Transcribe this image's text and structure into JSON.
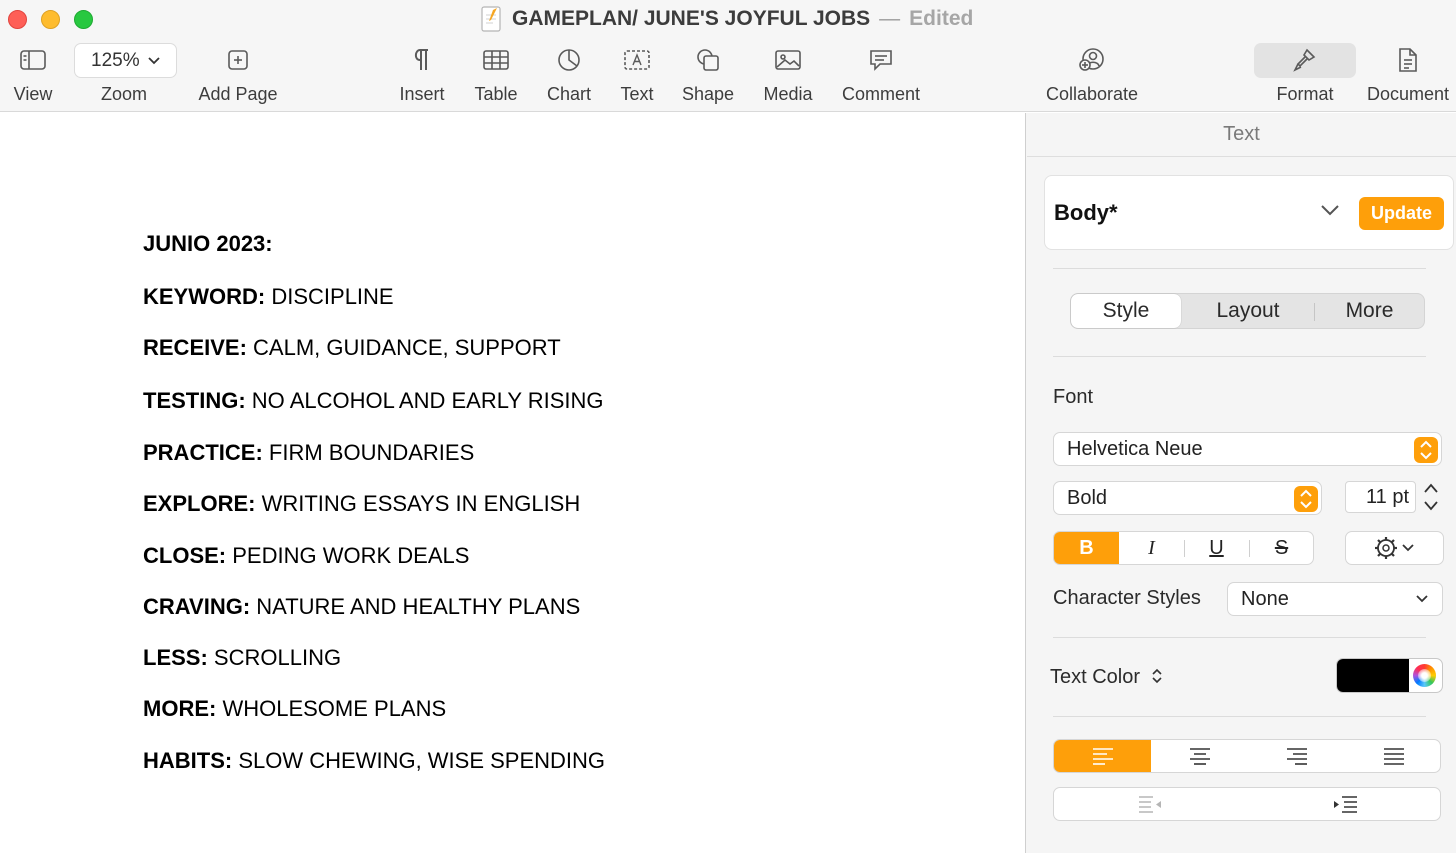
{
  "window": {
    "title": "GAMEPLAN/ JUNE'S JOYFUL JOBS",
    "separator": "—",
    "status": "Edited"
  },
  "toolbar": {
    "view_label": "View",
    "zoom_value": "125%",
    "zoom_label": "Zoom",
    "add_page_label": "Add Page",
    "insert_label": "Insert",
    "table_label": "Table",
    "chart_label": "Chart",
    "text_label": "Text",
    "shape_label": "Shape",
    "media_label": "Media",
    "comment_label": "Comment",
    "collaborate_label": "Collaborate",
    "format_label": "Format",
    "document_label": "Document"
  },
  "document": {
    "heading": "JUNIO 2023:",
    "lines": [
      {
        "key": "KEYWORD:",
        "value": "DISCIPLINE"
      },
      {
        "key": "RECEIVE:",
        "value": "CALM, GUIDANCE, SUPPORT"
      },
      {
        "key": "TESTING:",
        "value": "NO ALCOHOL AND EARLY RISING"
      },
      {
        "key": "PRACTICE:",
        "value": "FIRM BOUNDARIES"
      },
      {
        "key": "EXPLORE:",
        "value": "WRITING ESSAYS IN ENGLISH"
      },
      {
        "key": "CLOSE:",
        "value": "PEDING WORK DEALS"
      },
      {
        "key": "CRAVING:",
        "value": "NATURE AND HEALTHY PLANS"
      },
      {
        "key": "LESS:",
        "value": "SCROLLING"
      },
      {
        "key": "MORE:",
        "value": "WHOLESOME PLANS"
      },
      {
        "key": "HABITS:",
        "value": "SLOW CHEWING, WISE SPENDING"
      }
    ]
  },
  "sidebar": {
    "header": "Text",
    "paragraph_style": "Body*",
    "update_label": "Update",
    "tabs": [
      "Style",
      "Layout",
      "More"
    ],
    "font_label": "Font",
    "font_family": "Helvetica Neue",
    "font_style": "Bold",
    "font_size": "11 pt",
    "format_buttons": {
      "bold": "B",
      "italic": "I",
      "underline": "U",
      "strike": "S"
    },
    "char_styles_label": "Character Styles",
    "char_styles_value": "None",
    "text_color_label": "Text Color",
    "text_color": "#000000"
  },
  "colors": {
    "accent": "#fe9f0a",
    "traffic_red": "#fe5f57",
    "traffic_yellow": "#febc2e",
    "traffic_green": "#28c840"
  }
}
